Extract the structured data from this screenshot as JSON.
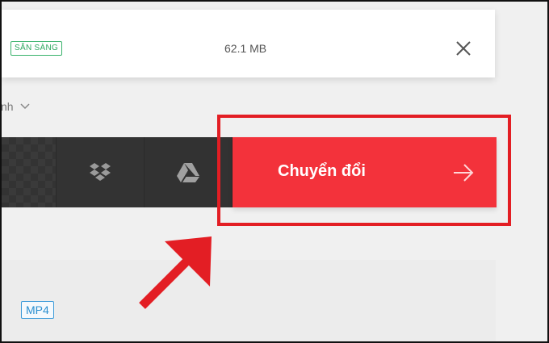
{
  "file_card": {
    "status_badge": "SẴN SÀNG",
    "size": "62.1 MB",
    "close_icon": "close-icon"
  },
  "quality_select": {
    "label": "nh",
    "chevron_icon": "chevron-down-icon"
  },
  "upload_sources": [
    {
      "name": "local-file",
      "icon": "checker-pattern"
    },
    {
      "name": "dropbox",
      "icon": "dropbox-icon"
    },
    {
      "name": "google-drive",
      "icon": "google-drive-icon"
    }
  ],
  "convert_button": {
    "label": "Chuyển đổi",
    "icon": "arrow-right-icon",
    "color": "#f3323b"
  },
  "output_format": {
    "label": "MP4",
    "color": "#2a8fd0"
  },
  "annotation": {
    "highlight_color": "#e31e24",
    "pointer_icon": "red-arrow-pointer"
  },
  "colors": {
    "ready_green": "#2fa860",
    "source_bar": "#3a3a3a"
  }
}
